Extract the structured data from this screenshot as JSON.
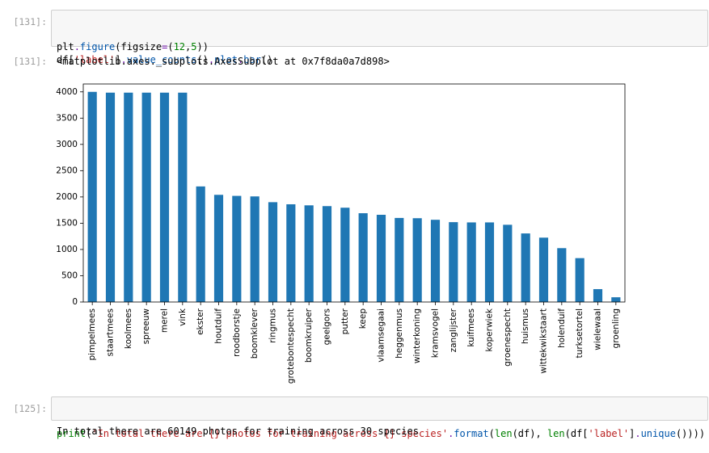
{
  "cells": [
    {
      "in_prompt": "[131]:",
      "code_lines": [
        [
          {
            "t": "plt",
            "c": "b"
          },
          {
            "t": ".",
            "c": "o"
          },
          {
            "t": "figure",
            "c": "attr"
          },
          {
            "t": "(",
            "c": "b"
          },
          {
            "t": "figsize",
            "c": "b"
          },
          {
            "t": "=",
            "c": "o"
          },
          {
            "t": "(",
            "c": "b"
          },
          {
            "t": "12",
            "c": "num"
          },
          {
            "t": ",",
            "c": "b"
          },
          {
            "t": "5",
            "c": "num"
          },
          {
            "t": "))",
            "c": "b"
          }
        ],
        [
          {
            "t": "df",
            "c": "b"
          },
          {
            "t": "[",
            "c": "b"
          },
          {
            "t": "'label'",
            "c": "s"
          },
          {
            "t": "]",
            "c": "b"
          },
          {
            "t": ".",
            "c": "o"
          },
          {
            "t": "value_counts",
            "c": "attr"
          },
          {
            "t": "()",
            "c": "b"
          },
          {
            "t": ".",
            "c": "o"
          },
          {
            "t": "plot",
            "c": "attr"
          },
          {
            "t": ".",
            "c": "o"
          },
          {
            "t": "bar",
            "c": "attr"
          },
          {
            "t": "()",
            "c": "b"
          }
        ]
      ],
      "out_prompt": "[131]:",
      "out_text": "<matplotlib.axes._subplots.AxesSubplot at 0x7f8da0a7d898>"
    },
    {
      "in_prompt": "[125]:",
      "code_lines": [
        [
          {
            "t": "print",
            "c": "k"
          },
          {
            "t": "(",
            "c": "b"
          },
          {
            "t": "'In total there are {} photos for training across {} species'",
            "c": "s"
          },
          {
            "t": ".",
            "c": "o"
          },
          {
            "t": "format",
            "c": "attr"
          },
          {
            "t": "(",
            "c": "b"
          },
          {
            "t": "len",
            "c": "k"
          },
          {
            "t": "(df), ",
            "c": "b"
          },
          {
            "t": "len",
            "c": "k"
          },
          {
            "t": "(df[",
            "c": "b"
          },
          {
            "t": "'label'",
            "c": "s"
          },
          {
            "t": "]",
            "c": "b"
          },
          {
            "t": ".",
            "c": "o"
          },
          {
            "t": "unique",
            "c": "attr"
          },
          {
            "t": "())))",
            "c": "b"
          }
        ]
      ],
      "out_text": "In total there are 60149 photos for training across 30 species"
    }
  ],
  "chart_data": {
    "type": "bar",
    "categories": [
      "pimpelmees",
      "staartmees",
      "koolmees",
      "spreeuw",
      "merel",
      "vink",
      "ekster",
      "houtduif",
      "roodborstje",
      "boomklever",
      "ringmus",
      "grotebontespecht",
      "boomkruiper",
      "geelgors",
      "putter",
      "keep",
      "vlaamsegaai",
      "heggenmus",
      "winterkoning",
      "kramsvogel",
      "zanglijster",
      "kuifmees",
      "koperwiek",
      "groenespecht",
      "huismus",
      "wittekwikstaart",
      "holenduif",
      "turksetortel",
      "wielewaal",
      "groenling"
    ],
    "values": [
      4000,
      3985,
      3985,
      3985,
      3985,
      3985,
      2200,
      2040,
      2020,
      2010,
      1900,
      1860,
      1840,
      1825,
      1795,
      1690,
      1660,
      1600,
      1595,
      1565,
      1520,
      1515,
      1515,
      1470,
      1305,
      1225,
      1025,
      835,
      245,
      90
    ],
    "ylim": [
      0,
      4150
    ],
    "yticks": [
      0,
      500,
      1000,
      1500,
      2000,
      2500,
      3000,
      3500,
      4000
    ],
    "color": "#1f77b4",
    "grid": false
  }
}
